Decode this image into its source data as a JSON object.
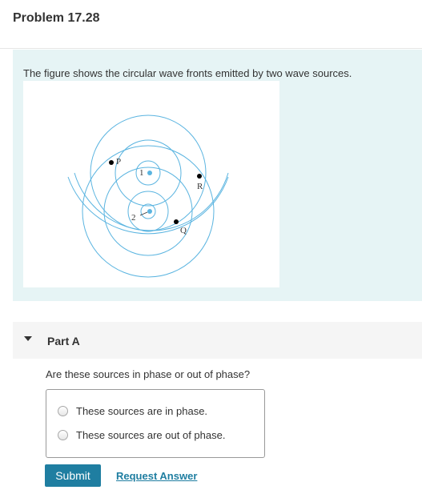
{
  "problem": {
    "title": "Problem 17.28"
  },
  "intro": {
    "text": "The figure shows the circular wave fronts emitted by two wave sources.",
    "figure": {
      "source_labels": [
        "1",
        "2"
      ],
      "point_labels": [
        "P",
        "R",
        "Q"
      ],
      "colors": {
        "wavefront": "#5ab4e0",
        "background": "#e6f4f5"
      }
    }
  },
  "part_a": {
    "title": "Part A",
    "question": "Are these sources in phase or out of phase?",
    "options": [
      "These sources are in phase.",
      "These sources are out of phase."
    ]
  },
  "actions": {
    "submit_label": "Submit",
    "request_answer_label": "Request Answer"
  },
  "colors": {
    "accent": "#1f7ea1"
  }
}
